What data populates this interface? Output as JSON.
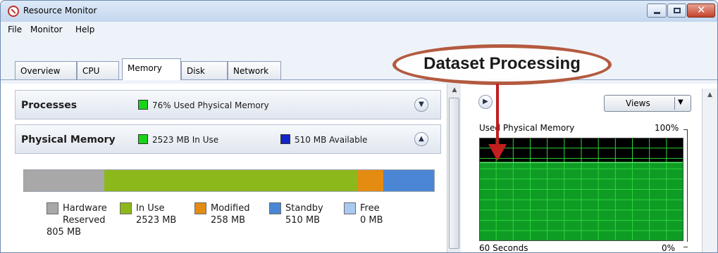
{
  "window": {
    "title": "Resource Monitor"
  },
  "menu": [
    "File",
    "Monitor",
    "Help"
  ],
  "tabs": [
    {
      "label": "Overview"
    },
    {
      "label": "CPU"
    },
    {
      "label": "Memory",
      "active": true
    },
    {
      "label": "Disk"
    },
    {
      "label": "Network"
    }
  ],
  "processes": {
    "title": "Processes",
    "summary": "76% Used Physical Memory",
    "chip_color": "#19d319",
    "collapse_icon": "chevron-down-icon"
  },
  "physical_memory": {
    "title": "Physical Memory",
    "in_use_text": "2523 MB In Use",
    "in_use_chip": "#19d319",
    "available_text": "510 MB Available",
    "available_chip": "#1124c9",
    "collapse_icon": "chevron-up-icon",
    "bar": [
      {
        "name": "Hardware Reserved",
        "mb": 805,
        "color": "#a8a8a8"
      },
      {
        "name": "In Use",
        "mb": 2523,
        "color": "#8db81b"
      },
      {
        "name": "Modified",
        "mb": 258,
        "color": "#e48b12"
      },
      {
        "name": "Standby",
        "mb": 510,
        "color": "#4a86d3"
      },
      {
        "name": "Free",
        "mb": 0,
        "color": "#a9c9ef"
      }
    ],
    "legend": [
      {
        "line1": "Hardware",
        "line2": "Reserved",
        "line3": "805 MB",
        "color": "#a8a8a8"
      },
      {
        "line1": "In Use",
        "line2": "2523 MB",
        "color": "#8db81b"
      },
      {
        "line1": "Modified",
        "line2": "258 MB",
        "color": "#e48b12"
      },
      {
        "line1": "Standby",
        "line2": "510 MB",
        "color": "#4a86d3"
      },
      {
        "line1": "Free",
        "line2": "0 MB",
        "color": "#a9c9ef"
      }
    ]
  },
  "right_pane": {
    "views_label": "Views",
    "graph_title": "Used Physical Memory",
    "max_label": "100%",
    "min_label": "0%",
    "time_label": "60 Seconds",
    "used_percent": 76,
    "fill_color": "#0e9c25",
    "grid_color": "#2fd33c"
  },
  "annotation": {
    "text": "Dataset Processing",
    "color": "#b45a3f"
  }
}
